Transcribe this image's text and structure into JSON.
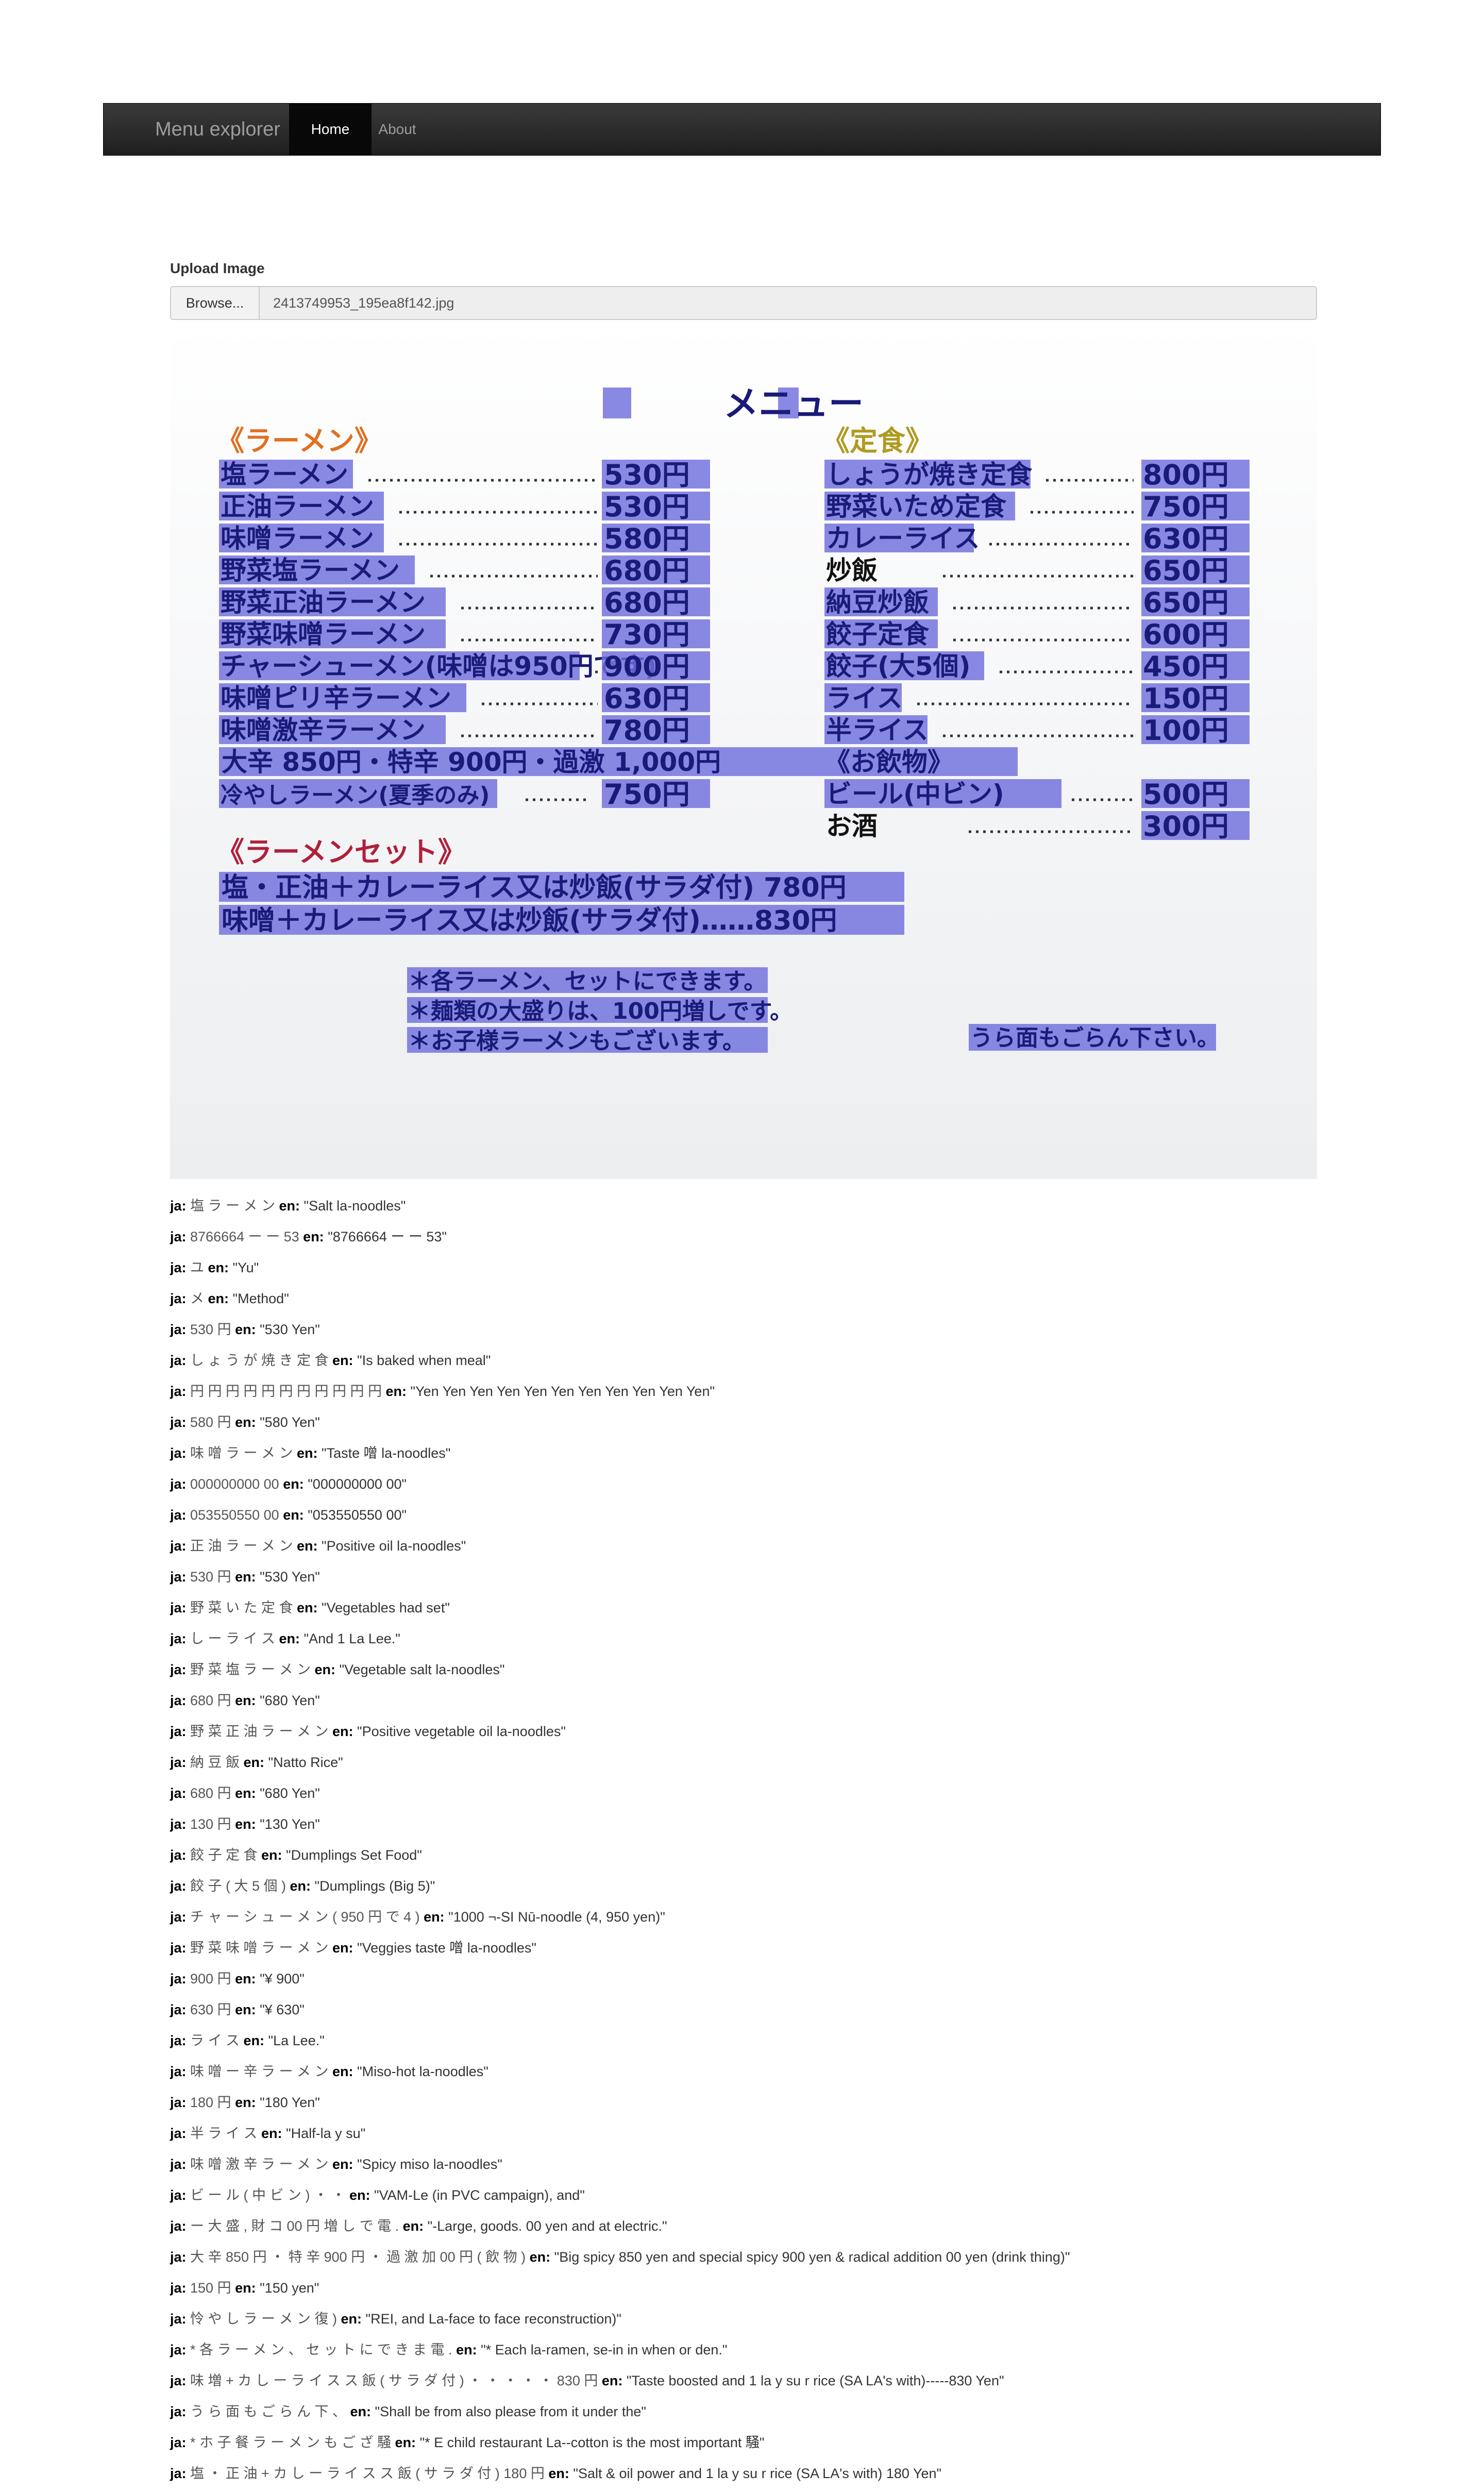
{
  "navbar": {
    "brand": "Menu explorer",
    "items": [
      {
        "label": "Home",
        "active": true
      },
      {
        "label": "About",
        "active": false
      }
    ]
  },
  "upload": {
    "label": "Upload Image",
    "browse_label": "Browse...",
    "file_name": "2413749953_195ea8f142.jpg"
  },
  "menu_image": {
    "title": "メニュー",
    "left_header": "《ラーメン》",
    "right_header": "《定食》",
    "left_items": [
      {
        "name": "塩ラーメン",
        "price": "530円"
      },
      {
        "name": "正油ラーメン",
        "price": "530円"
      },
      {
        "name": "味噌ラーメン",
        "price": "580円"
      },
      {
        "name": "野菜塩ラーメン",
        "price": "680円"
      },
      {
        "name": "野菜正油ラーメン",
        "price": "680円"
      },
      {
        "name": "野菜味噌ラーメン",
        "price": "730円"
      },
      {
        "name": "チャーシューメン(味噌は950円です)",
        "price": "900円"
      },
      {
        "name": "味噌ピリ辛ラーメン",
        "price": "630円"
      },
      {
        "name": "味噌激辛ラーメン",
        "price": "780円"
      }
    ],
    "left_extra": "大辛 850円・特辛 900円・過激 1,000円",
    "left_last": {
      "name": "冷やしラーメン(夏季のみ)",
      "price": "750円"
    },
    "right_items": [
      {
        "name": "しょうが焼き定食",
        "price": "800円"
      },
      {
        "name": "野菜いため定食",
        "price": "750円"
      },
      {
        "name": "カレーライス",
        "price": "630円"
      },
      {
        "name": "炒飯",
        "price": "650円"
      },
      {
        "name": "納豆炒飯",
        "price": "650円"
      },
      {
        "name": "餃子定食",
        "price": "600円"
      },
      {
        "name": "餃子(大5個)",
        "price": "450円"
      },
      {
        "name": "ライス",
        "price": "150円"
      },
      {
        "name": "半ライス",
        "price": "100円"
      }
    ],
    "drinks_header": "《お飲物》",
    "drinks": [
      {
        "name": "ビール(中ビン)",
        "price": "500円"
      },
      {
        "name": "お酒",
        "price": "300円"
      }
    ],
    "set_header": "《ラーメンセット》",
    "sets": [
      "塩・正油＋カレーライス又は炒飯(サラダ付) 780円",
      "味噌＋カレーライス又は炒飯(サラダ付)……830円"
    ],
    "notes": [
      "＊各ラーメン、セットにできます。",
      "＊麺類の大盛りは、100円増しです。",
      "＊お子様ラーメンもございます。"
    ],
    "back_note": "うら面もごらん下さい。"
  },
  "results": [
    {
      "ja": "塩 ラ ー メ ン",
      "en": "\"Salt la-noodles\""
    },
    {
      "ja": "8766664 ー ー 53",
      "en": "\"8766664 ー ー 53\""
    },
    {
      "ja": "ユ",
      "en": "\"Yu\""
    },
    {
      "ja": "メ",
      "en": "\"Method\""
    },
    {
      "ja": "530 円",
      "en": "\"530 Yen\""
    },
    {
      "ja": "し ょ う が 焼 き 定 食",
      "en": "\"Is baked when meal\""
    },
    {
      "ja": "円 円 円 円 円 円 円 円 円 円 円",
      "en": "\"Yen Yen Yen Yen Yen Yen Yen Yen Yen Yen Yen\""
    },
    {
      "ja": "580 円",
      "en": "\"580 Yen\""
    },
    {
      "ja": "味 噌 ラ ー メ ン",
      "en": "\"Taste 噌 la-noodles\""
    },
    {
      "ja": "000000000 00",
      "en": "\"000000000 00\""
    },
    {
      "ja": "053550550 00",
      "en": "\"053550550 00\""
    },
    {
      "ja": "正 油 ラ ー メ ン",
      "en": "\"Positive oil la-noodles\""
    },
    {
      "ja": "530 円",
      "en": "\"530 Yen\""
    },
    {
      "ja": "野 菜 い た 定 食",
      "en": "\"Vegetables had set\""
    },
    {
      "ja": "し ー ラ イ ス",
      "en": "\"And 1 La Lee.\""
    },
    {
      "ja": "野 菜 塩 ラ ー メ ン",
      "en": "\"Vegetable salt la-noodles\""
    },
    {
      "ja": "680 円",
      "en": "\"680 Yen\""
    },
    {
      "ja": "野 菜 正 油 ラ ー メ ン",
      "en": "\"Positive vegetable oil la-noodles\""
    },
    {
      "ja": "納 豆 飯",
      "en": "\"Natto Rice\""
    },
    {
      "ja": "680 円",
      "en": "\"680 Yen\""
    },
    {
      "ja": "130 円",
      "en": "\"130 Yen\""
    },
    {
      "ja": "餃 子 定 食",
      "en": "\"Dumplings Set Food\""
    },
    {
      "ja": "餃 子 ( 大 5 個 )",
      "en": "\"Dumplings (Big 5)\""
    },
    {
      "ja": "チ ャ ー シ ュ ー メ ン ( 950 円 で 4 )",
      "en": "\"1000 ¬-SI Nū-noodle (4, 950 yen)\""
    },
    {
      "ja": "野 菜 味 噌 ラ ー メ ン",
      "en": "\"Veggies taste 噌 la-noodles\""
    },
    {
      "ja": "900 円",
      "en": "\"¥ 900\""
    },
    {
      "ja": "630 円",
      "en": "\"¥ 630\""
    },
    {
      "ja": "ラ イ ス",
      "en": "\"La Lee.\""
    },
    {
      "ja": "味 噌 ー 辛 ラ ー メ ン",
      "en": "\"Miso-hot la-noodles\""
    },
    {
      "ja": "180 円",
      "en": "\"180 Yen\""
    },
    {
      "ja": "半 ラ イ ス",
      "en": "\"Half-la y su\""
    },
    {
      "ja": "味 噌 激 辛 ラ ー メ ン",
      "en": "\"Spicy miso la-noodles\""
    },
    {
      "ja": "ビ ー ル ( 中 ビ ン ) ・ ・",
      "en": "\"VAM-Le (in PVC campaign), and\""
    },
    {
      "ja": "ー 大 盛 , 財 コ 00 円 増 し で 電 .",
      "en": "\"-Large, goods. 00 yen and at electric.\""
    },
    {
      "ja": "大 辛 850 円 ・ 特 辛 900 円 ・ 過 激 加 00 円 ( 飲 物 )",
      "en": "\"Big spicy 850 yen and special spicy 900 yen & radical addition 00 yen (drink thing)\""
    },
    {
      "ja": "150 円",
      "en": "\"150 yen\""
    },
    {
      "ja": "怜 や し ラ ー メ ン 復 )",
      "en": "\"REI, and La-face to face reconstruction)\""
    },
    {
      "ja": "* 各 ラ ー メ ン 、 セ ッ ト に で き ま 電 .",
      "en": "\"* Each la-ramen, se-in in when or den.\""
    },
    {
      "ja": "味 増 + カ し ー ラ イ ス ス 飯 ( サ ラ ダ 付 ) ・ ・ ・ ・ ・ 830 円",
      "en": "\"Taste boosted and 1 la y su r rice (SA LA's with)-----830 Yen\""
    },
    {
      "ja": "う ら 面 も ご ら ん 下 、",
      "en": "\"Shall be from also please from it under the\""
    },
    {
      "ja": "* ホ 子 餐 ラ ー メ ン も ご ざ 騒",
      "en": "\"* E child restaurant La--cotton is the most important 騒\""
    },
    {
      "ja": "塩 ・ 正 油 + カ し ー ラ イ ス ス 飯 ( サ ラ ダ 付 ) 180 円",
      "en": "\"Salt & oil power and 1 la y su r rice (SA LA's with) 180 Yen\""
    }
  ],
  "labels": {
    "ja": "ja:",
    "en": "en:"
  },
  "colors": {
    "highlight": "#6f6fdd",
    "highlight_text": "#1a1a7a",
    "navbar": "#222222",
    "header_orange": "#e07020",
    "header_olive": "#b09a20",
    "header_red": "#b0203a"
  }
}
